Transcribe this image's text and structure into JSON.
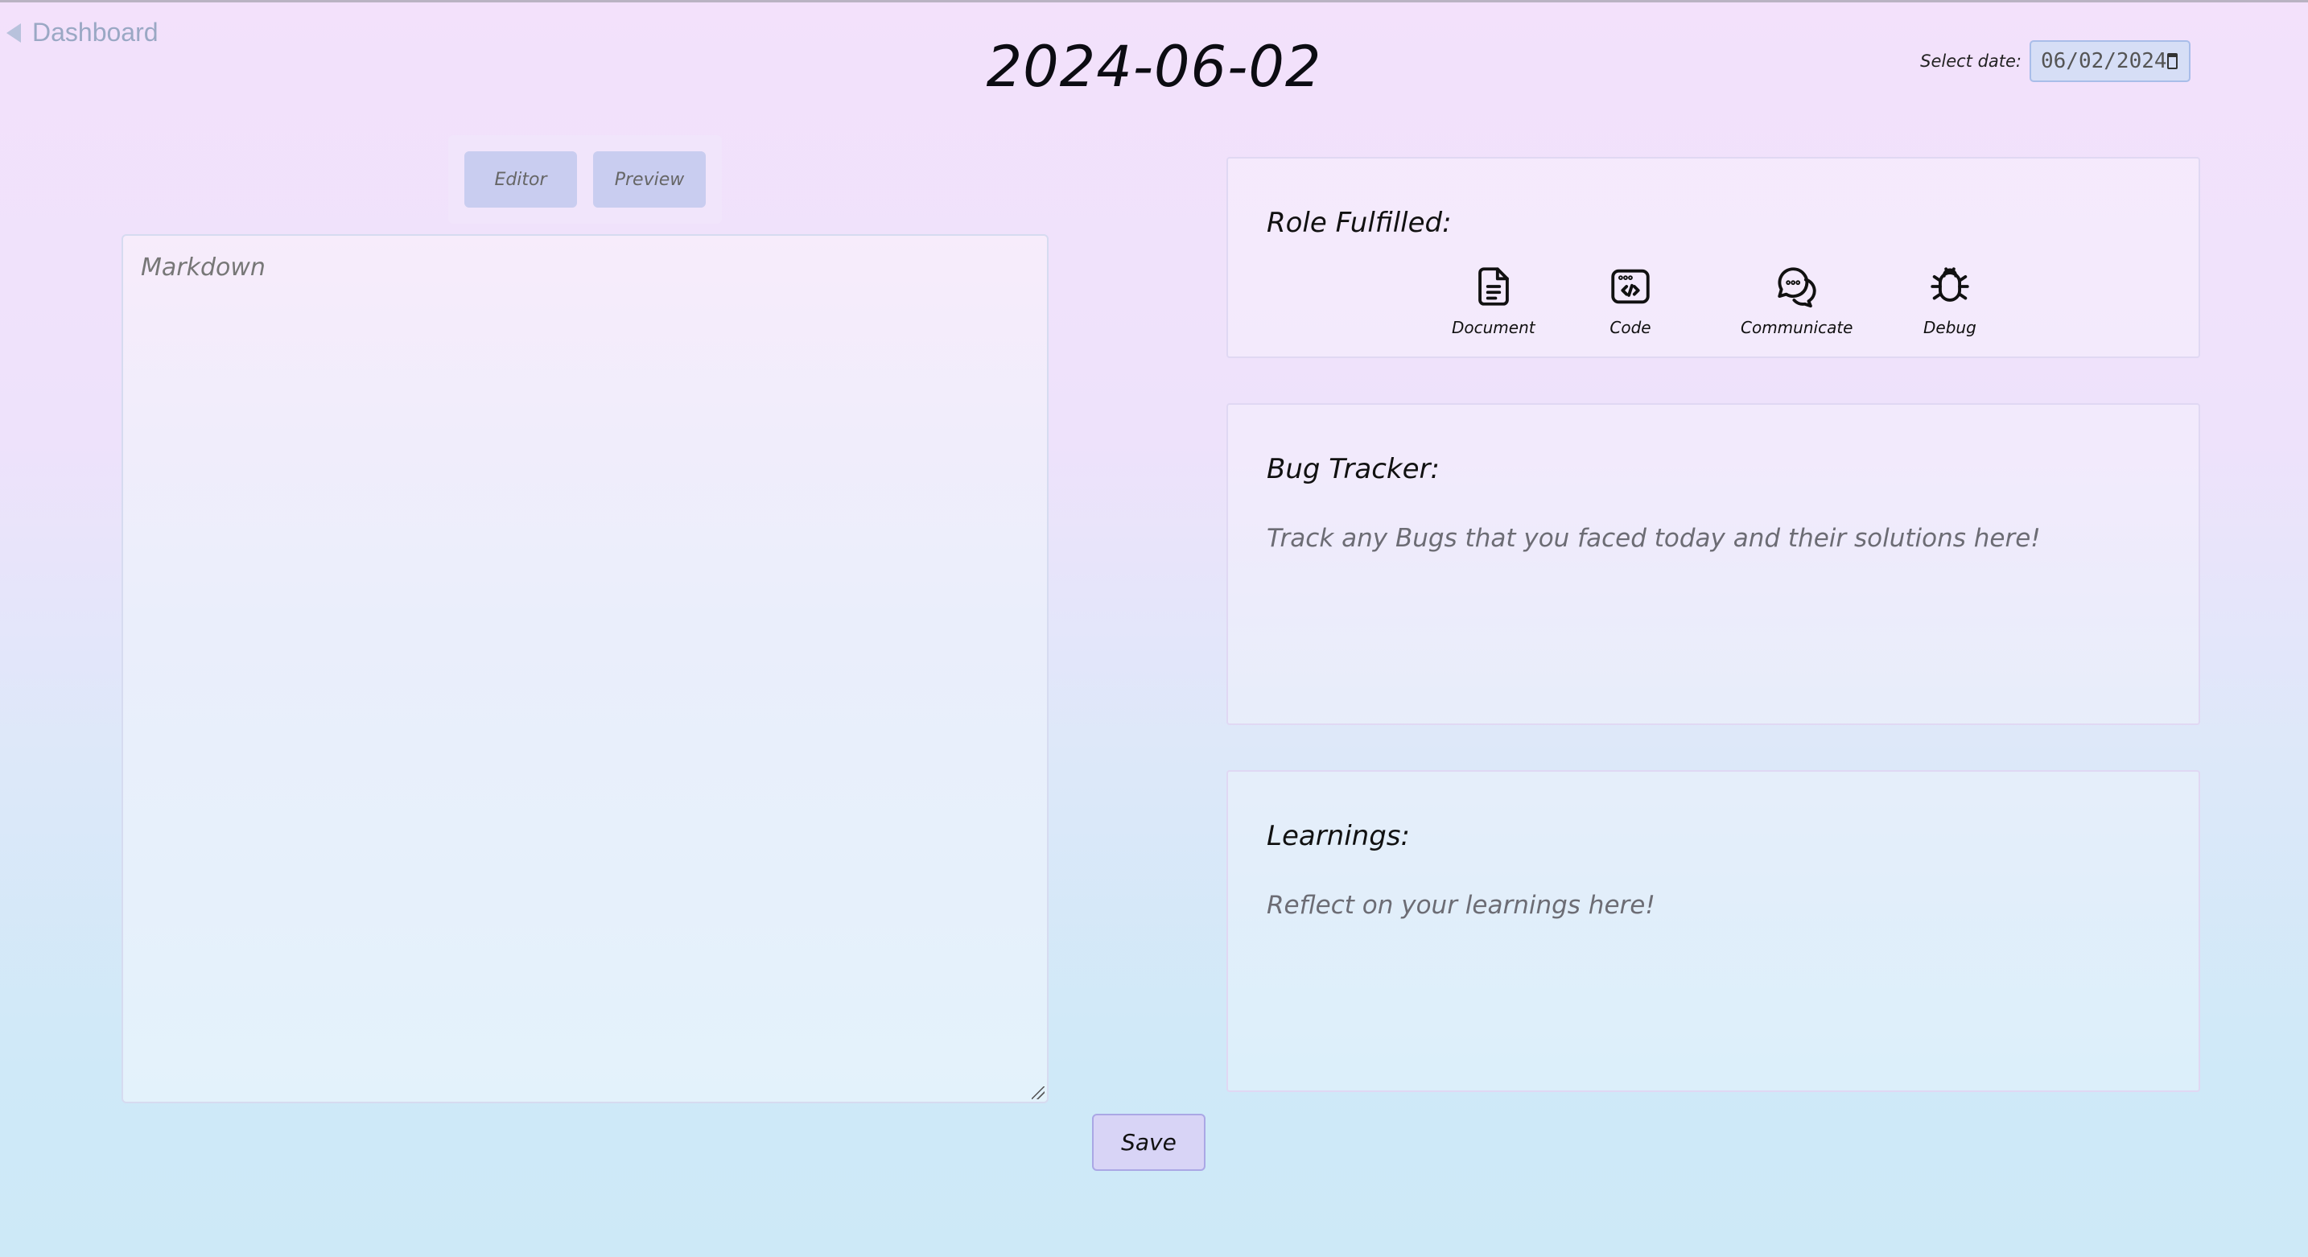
{
  "nav": {
    "back_label": "Dashboard"
  },
  "header": {
    "title": "2024-06-02"
  },
  "date_picker": {
    "label": "Select date:",
    "value": "06/02/2024"
  },
  "view_toggle": {
    "editor_label": "Editor",
    "preview_label": "Preview"
  },
  "editor": {
    "placeholder": "Markdown"
  },
  "save_label": "Save",
  "role_card": {
    "title": "Role Fulfilled:",
    "roles": [
      {
        "label": "Document",
        "icon": "document-icon"
      },
      {
        "label": "Code",
        "icon": "code-icon"
      },
      {
        "label": "Communicate",
        "icon": "communicate-icon"
      },
      {
        "label": "Debug",
        "icon": "debug-icon"
      }
    ]
  },
  "bug_card": {
    "title": "Bug Tracker:",
    "placeholder": "Track any Bugs that you faced today and their solutions here!"
  },
  "learn_card": {
    "title": "Learnings:",
    "placeholder": "Reflect on your learnings here!"
  },
  "colors": {
    "accent": "#c9cdf0",
    "save_bg": "#d8d4f6",
    "date_bg": "#d6def6"
  }
}
